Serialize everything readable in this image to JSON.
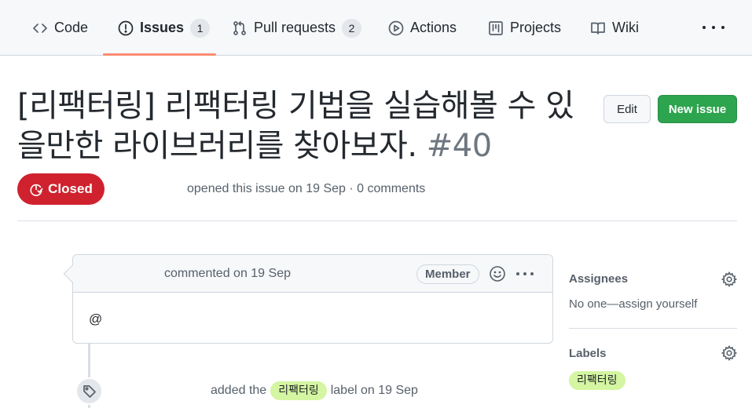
{
  "nav": {
    "tabs": [
      {
        "label": "Code",
        "icon": "code-icon"
      },
      {
        "label": "Issues",
        "icon": "issue-opened-icon",
        "count": "1"
      },
      {
        "label": "Pull requests",
        "icon": "git-pull-request-icon",
        "count": "2"
      },
      {
        "label": "Actions",
        "icon": "play-icon"
      },
      {
        "label": "Projects",
        "icon": "project-icon"
      },
      {
        "label": "Wiki",
        "icon": "book-icon"
      }
    ],
    "active_tab": "Issues",
    "active_underline_color": "#fd8c73"
  },
  "issue": {
    "title": "[리팩터링] 리팩터링 기법을 실습해볼 수 있을만한 라이브러리를 찾아보자.",
    "number": "#40",
    "state": "Closed",
    "state_color": "#cf222e",
    "meta": "opened this issue on 19 Sep · 0 comments"
  },
  "buttons": {
    "edit": "Edit",
    "new_issue": "New issue",
    "new_issue_color": "#2da44e"
  },
  "comment": {
    "meta": "commented on 19 Sep",
    "role": "Member",
    "body": "@"
  },
  "event": {
    "prefix": "added the",
    "label": "리팩터링",
    "suffix": "label on 19 Sep"
  },
  "sidebar": {
    "assignees": {
      "heading": "Assignees",
      "value": "No one—assign yourself"
    },
    "labels": {
      "heading": "Labels",
      "items": [
        "리팩터링"
      ],
      "label_color": "#d4f5a1"
    }
  }
}
